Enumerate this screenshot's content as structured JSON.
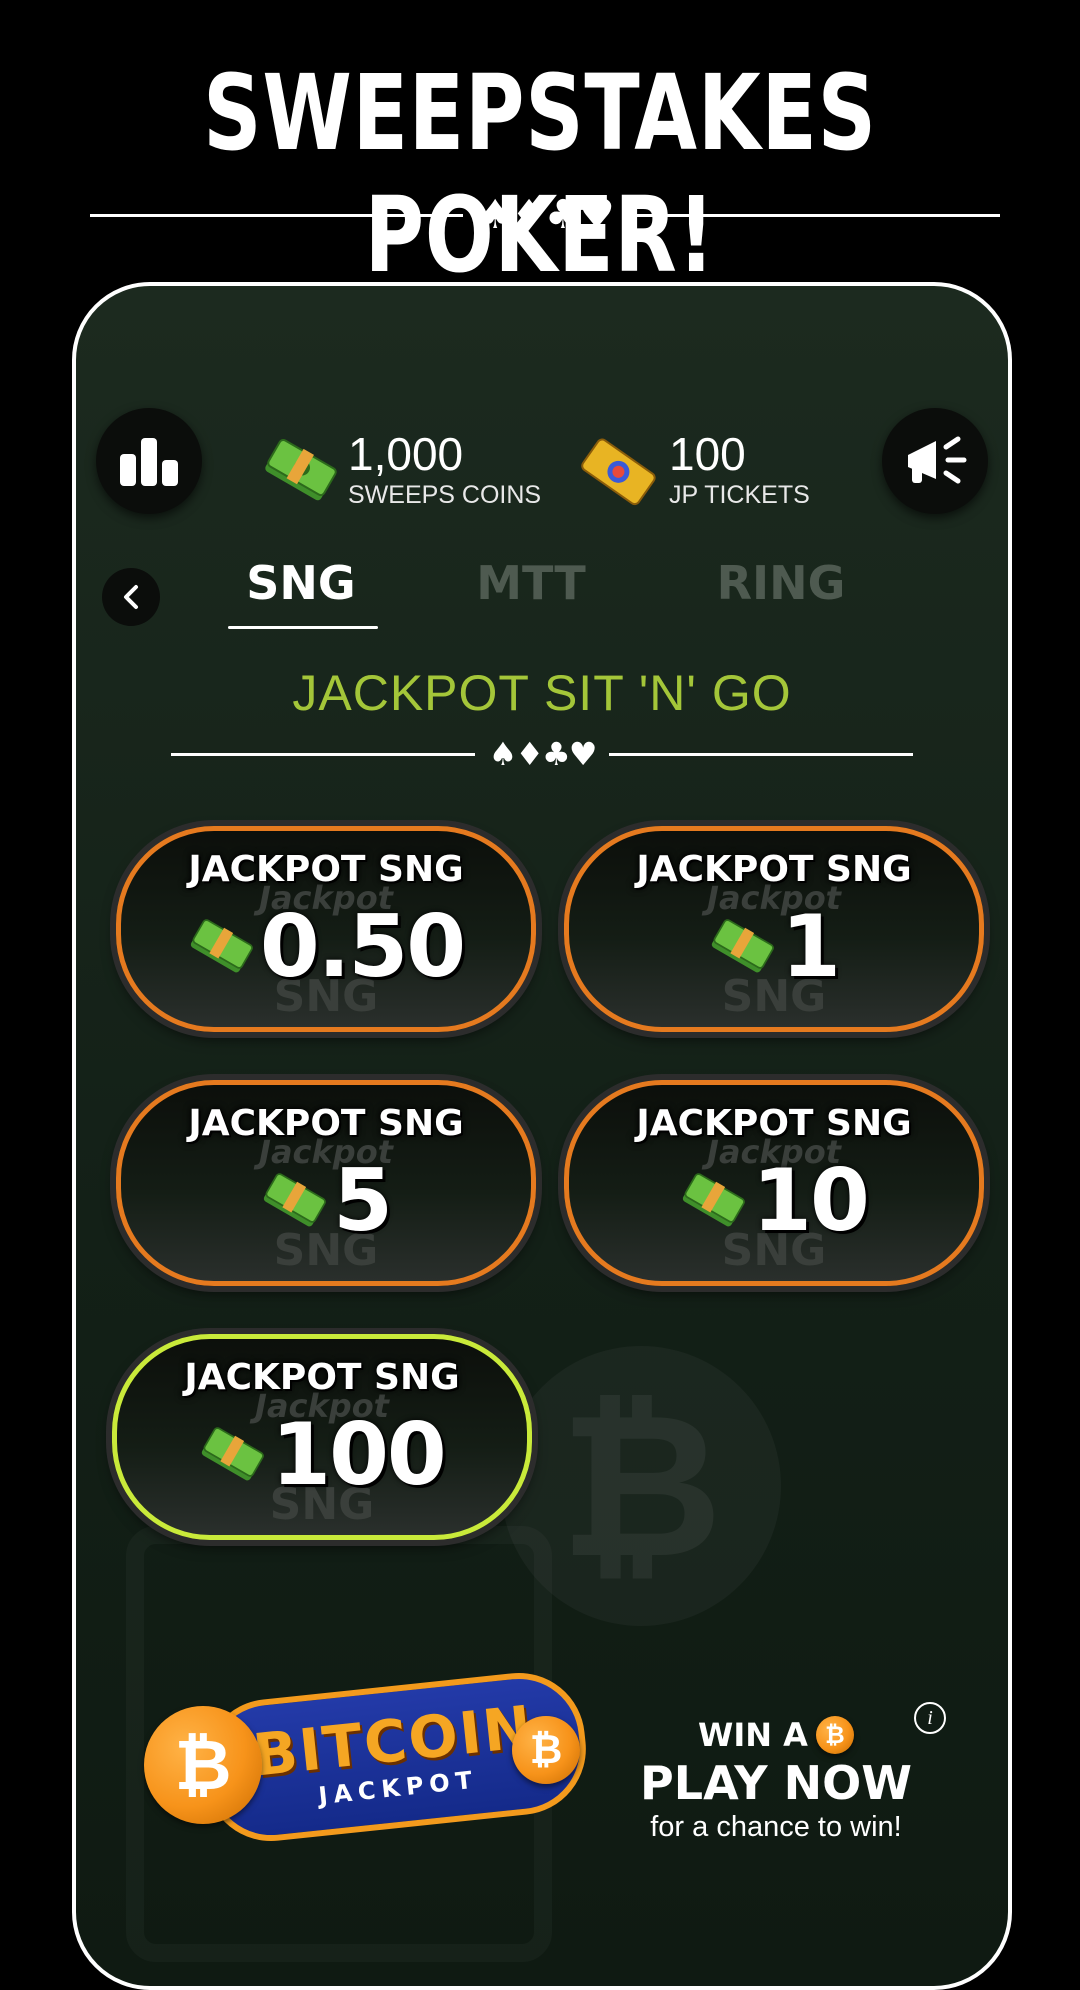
{
  "headline": "SWEEPSTAKES POKER!",
  "suits": "♠♦♣♥",
  "balances": {
    "coins": {
      "value": "1,000",
      "label": "SWEEPS COINS",
      "icon": "cash-stack-icon"
    },
    "tickets": {
      "value": "100",
      "label": "JP TICKETS",
      "icon": "ticket-icon"
    }
  },
  "tabs": [
    {
      "label": "SNG",
      "active": true
    },
    {
      "label": "MTT",
      "active": false
    },
    {
      "label": "RING",
      "active": false
    }
  ],
  "section_title": "JACKPOT SIT 'N' GO",
  "games": [
    {
      "title": "JACKPOT SNG",
      "value": "0.50",
      "ghost_top": "Jackpot",
      "ghost_bottom": "SNG"
    },
    {
      "title": "JACKPOT SNG",
      "value": "1",
      "ghost_top": "Jackpot",
      "ghost_bottom": "SNG"
    },
    {
      "title": "JACKPOT SNG",
      "value": "5",
      "ghost_top": "Jackpot",
      "ghost_bottom": "SNG"
    },
    {
      "title": "JACKPOT SNG",
      "value": "10",
      "ghost_top": "Jackpot",
      "ghost_bottom": "SNG"
    },
    {
      "title": "JACKPOT SNG",
      "value": "100",
      "ghost_top": "Jackpot",
      "ghost_bottom": "SNG"
    }
  ],
  "banner": {
    "title": "BITCOIN",
    "subtitle": "JACKPOT",
    "coin_symbol": "₿"
  },
  "cta": {
    "win": "WIN A",
    "play": "PLAY NOW",
    "chance": "for a chance to win!"
  },
  "colors": {
    "accent_green": "#a4c639",
    "game_border": "#e57a1f",
    "featured_border": "#c9ea3a",
    "bitcoin_orange": "#f7931a"
  }
}
